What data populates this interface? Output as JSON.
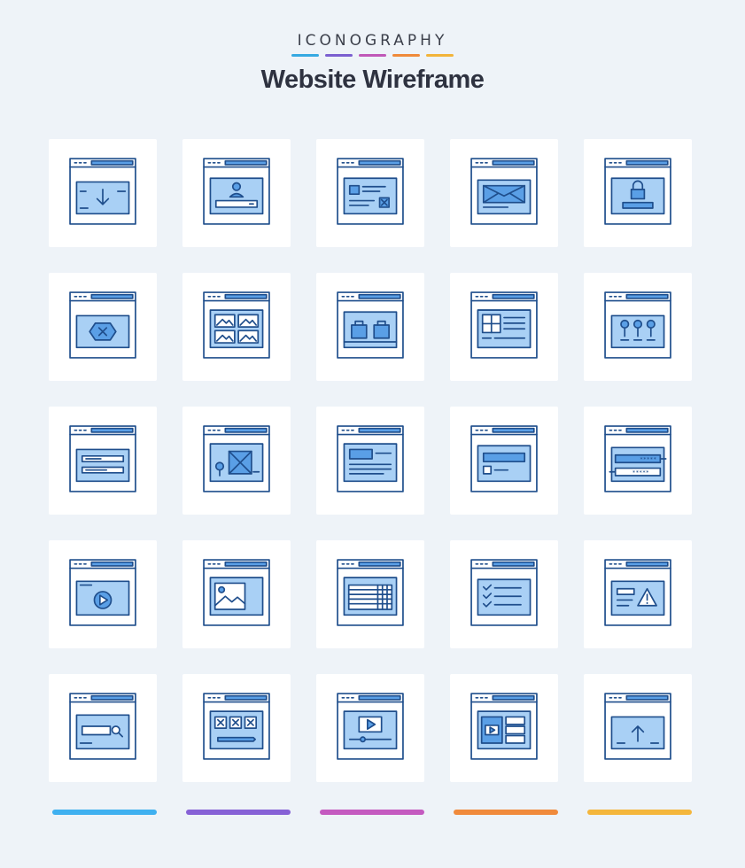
{
  "header": {
    "brand": "ICONOGRAPHY",
    "title": "Website Wireframe",
    "swatch_colors": [
      "#36a9e1",
      "#7b5fd0",
      "#c058b8",
      "#ef8a3a",
      "#f2b43a"
    ]
  },
  "footer": {
    "bar_colors": [
      "#3fb0f0",
      "#8661d6",
      "#c45ac0",
      "#f08a3c",
      "#f4b63c"
    ]
  },
  "palette": {
    "stroke": "#1f4e8c",
    "fill": "#5a9fe6",
    "light": "#a9d0f5",
    "white": "#ffffff"
  },
  "icons": [
    {
      "name": "download-page-icon"
    },
    {
      "name": "user-profile-page-icon"
    },
    {
      "name": "content-layout-page-icon"
    },
    {
      "name": "email-page-icon"
    },
    {
      "name": "locked-page-icon"
    },
    {
      "name": "error-page-icon"
    },
    {
      "name": "image-gallery-page-icon"
    },
    {
      "name": "shopping-page-icon"
    },
    {
      "name": "dashboard-page-icon"
    },
    {
      "name": "team-page-icon"
    },
    {
      "name": "form-page-icon"
    },
    {
      "name": "location-image-page-icon"
    },
    {
      "name": "article-page-icon"
    },
    {
      "name": "login-page-icon"
    },
    {
      "name": "password-page-icon"
    },
    {
      "name": "video-player-page-icon"
    },
    {
      "name": "image-article-page-icon"
    },
    {
      "name": "table-page-icon"
    },
    {
      "name": "checklist-page-icon"
    },
    {
      "name": "warning-page-icon"
    },
    {
      "name": "search-page-icon"
    },
    {
      "name": "design-edit-page-icon"
    },
    {
      "name": "video-timeline-page-icon"
    },
    {
      "name": "video-playlist-page-icon"
    },
    {
      "name": "upload-page-icon"
    }
  ]
}
